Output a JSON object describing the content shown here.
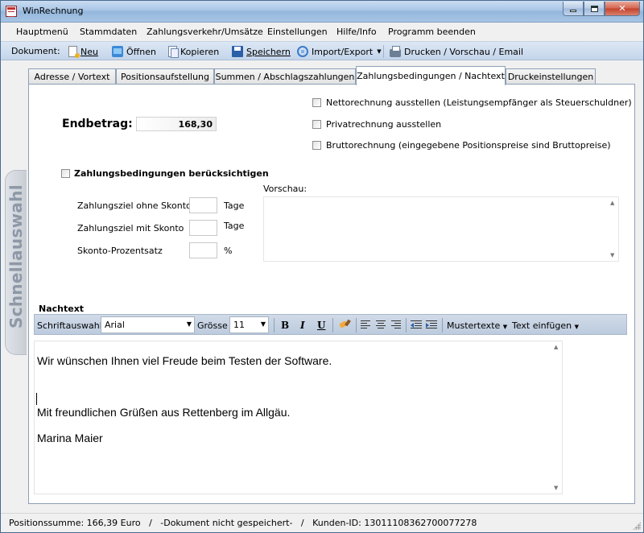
{
  "window": {
    "title": "WinRechnung"
  },
  "menu": [
    "Hauptmenü",
    "Stammdaten",
    "Zahlungsverkehr/Umsätze",
    "Einstellungen",
    "Hilfe/Info",
    "Programm beenden"
  ],
  "toolbar": {
    "label": "Dokument:",
    "new": "Neu",
    "open": "Öffnen",
    "copy": "Kopieren",
    "save": "Speichern",
    "import_export": "Import/Export",
    "print": "Drucken / Vorschau / Email"
  },
  "tabs": [
    "Adresse / Vortext",
    "Positionsaufstellung",
    "Summen / Abschlagszahlungen",
    "Zahlungsbedingungen / Nachtext",
    "Druckeinstellungen"
  ],
  "side_tab": "Schnellauswahl",
  "endbetrag": {
    "label": "Endbetrag:",
    "value": "168,30"
  },
  "options": {
    "netto": "Nettorechnung ausstellen (Leistungsempfänger als Steuerschuldner)",
    "privat": "Privatrechnung ausstellen",
    "brutto": "Bruttorechnung (eingegebene Positionspreise sind Bruttopreise)"
  },
  "payment": {
    "use_label": "Zahlungsbedingungen berücksichtigen",
    "ohne_skonto": "Zahlungsziel ohne Skonto",
    "mit_skonto": "Zahlungsziel mit Skonto",
    "skonto_pct": "Skonto-Prozentsatz",
    "unit_days": "Tage",
    "unit_pct": "%",
    "preview_label": "Vorschau:"
  },
  "nachtext": {
    "title": "Nachtext",
    "font_label": "Schriftauswahl",
    "font_value": "Arial",
    "size_label": "Grösse",
    "size_value": "11",
    "bold": "B",
    "italic": "I",
    "underline": "U",
    "mustertexte": "Mustertexte",
    "text_einfuegen": "Text einfügen",
    "lines": [
      "Wir wünschen Ihnen viel Freude beim Testen der Software.",
      "Mit freundlichen Grüßen aus Rettenberg im Allgäu.",
      "Marina Maier"
    ]
  },
  "status": "Positionssumme: 166,39 Euro   /   -Dokument nicht gespeichert-   /   Kunden-ID: 13011108362700077278"
}
